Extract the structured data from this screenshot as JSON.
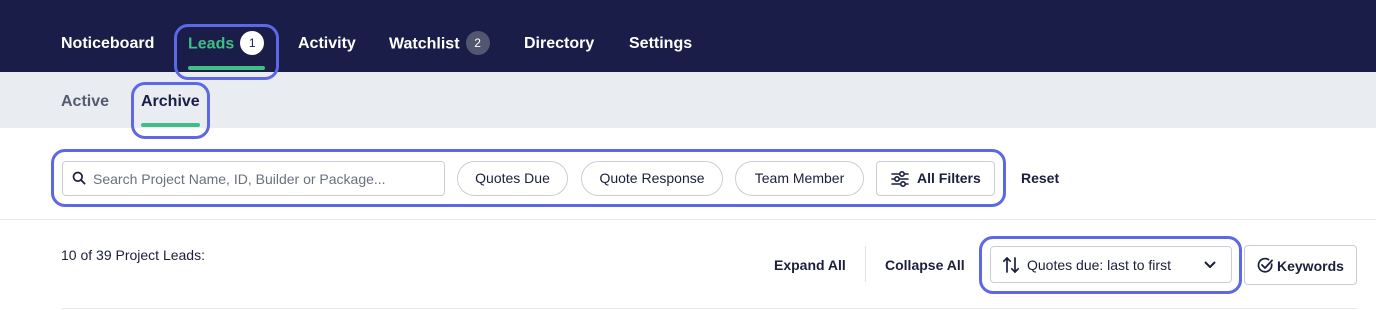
{
  "topnav": {
    "items": [
      {
        "label": "Noticeboard"
      },
      {
        "label": "Leads",
        "badge": "1",
        "active": true
      },
      {
        "label": "Activity"
      },
      {
        "label": "Watchlist",
        "badge": "2"
      },
      {
        "label": "Directory"
      },
      {
        "label": "Settings"
      }
    ]
  },
  "subnav": {
    "items": [
      {
        "label": "Active"
      },
      {
        "label": "Archive",
        "active": true
      }
    ]
  },
  "filters": {
    "search_placeholder": "Search Project Name, ID, Builder or Package...",
    "search_value": "",
    "pills": [
      {
        "label": "Quotes Due"
      },
      {
        "label": "Quote Response"
      },
      {
        "label": "Team Member"
      }
    ],
    "all_filters_label": "All Filters",
    "reset_label": "Reset"
  },
  "results": {
    "count_text": "10 of 39 Project Leads:",
    "expand_all_label": "Expand All",
    "collapse_all_label": "Collapse All",
    "sort_label": "Quotes due: last to first",
    "keywords_label": "Keywords"
  },
  "colors": {
    "nav_bg": "#1a1d47",
    "accent_green": "#3fbf86",
    "subnav_bg": "#e9edf2",
    "highlight": "#5c68e6"
  },
  "icons": [
    "search-icon",
    "sliders-icon",
    "sort-arrows-icon",
    "chevron-down-icon",
    "check-circle-icon"
  ]
}
